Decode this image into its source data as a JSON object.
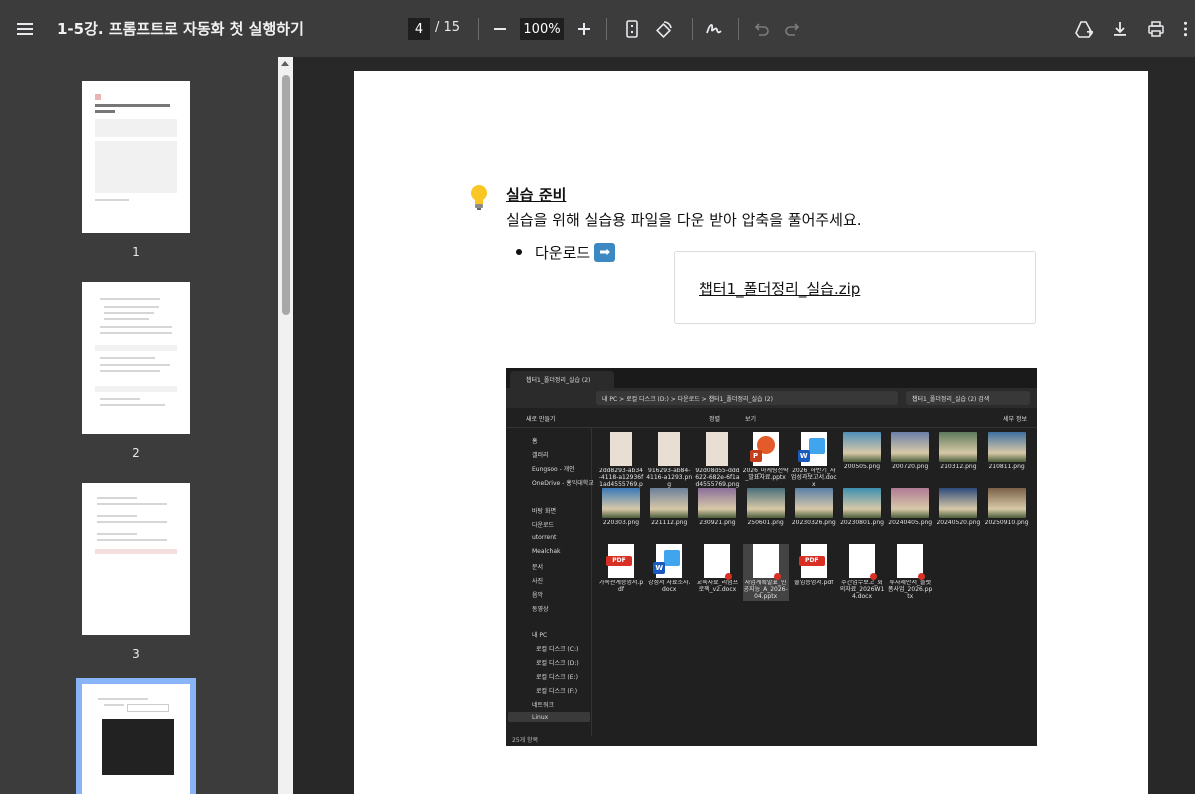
{
  "toolbar": {
    "title": "1-5강. 프롬프트로 자동화 첫 실행하기",
    "current_page": "4",
    "total_pages": "/ 15",
    "zoom": "100%"
  },
  "sidebar": {
    "thumbnails": [
      {
        "label": "1"
      },
      {
        "label": "2"
      },
      {
        "label": "3"
      }
    ]
  },
  "page": {
    "callout_title": "실습 준비",
    "callout_text": "실습을 위해 실습용 파일을 다운 받아 압축을 풀어주세요.",
    "download_label": "다운로드",
    "arrow_glyph": "➡",
    "file_link": "챕터1_폴더정리_실습.zip"
  },
  "explorer": {
    "tab_title": "챕터1_폴더정리_실습 (2)",
    "address": "내 PC  >  로컬 디스크 (D:)  >  다운로드  >  챕터1_폴더정리_실습 (2)",
    "search_placeholder": "챕터1_폴더정리_실습 (2) 검색",
    "cmd_new": "새로 만들기",
    "cmd_sort": "정렬",
    "cmd_view": "보기",
    "cmd_details": "세부 정보",
    "nav": [
      "홈",
      "갤러리",
      "Eungsoo - 개인",
      "OneDrive - 홍익대학교",
      "바탕 화면",
      "다운로드",
      "utorrent",
      "Mealchak",
      "문서",
      "사진",
      "음악",
      "동영상",
      "내 PC",
      "로컬 디스크 (C:)",
      "로컬 디스크 (D:)",
      "로컬 디스크 (E:)",
      "로컬 디스크 (F:)",
      "네트워크",
      "Linux"
    ],
    "status": "25개 항목",
    "files": [
      {
        "name": "2dd8293-ab34-4118-a12936f1ad4555769.png",
        "kind": "receipt"
      },
      {
        "name": "916293-ab84-4116-a1293.png",
        "kind": "receipt"
      },
      {
        "name": "92d08d55-ddd622-682e-6f1ad4555769.png",
        "kind": "receipt"
      },
      {
        "name": "2026_마케팅전략_발표자료.pptx",
        "kind": "pptx"
      },
      {
        "name": "2026_하반기_사업성과보고서.docx",
        "kind": "docx"
      },
      {
        "name": "200505.png",
        "kind": "photo",
        "color": "#4f8fb8"
      },
      {
        "name": "200720.png",
        "kind": "photo",
        "color": "#6a7fa8"
      },
      {
        "name": "210312.png",
        "kind": "photo",
        "color": "#5b7a5a"
      },
      {
        "name": "210811.png",
        "kind": "photo",
        "color": "#3f6fa0"
      },
      {
        "name": "220303.png",
        "kind": "photo",
        "color": "#3a79b8"
      },
      {
        "name": "221112.png",
        "kind": "photo",
        "color": "#6b7f9a"
      },
      {
        "name": "230921.png",
        "kind": "photo",
        "color": "#8a6f9a"
      },
      {
        "name": "250601.png",
        "kind": "photo",
        "color": "#4a6e7a"
      },
      {
        "name": "20230326.png",
        "kind": "photo",
        "color": "#5a7fa8"
      },
      {
        "name": "20230801.png",
        "kind": "photo",
        "color": "#3d8fb0"
      },
      {
        "name": "20240405.png",
        "kind": "photo",
        "color": "#b07a94"
      },
      {
        "name": "20240520.png",
        "kind": "photo",
        "color": "#2e4a7a"
      },
      {
        "name": "20250910.png",
        "kind": "photo",
        "color": "#7a6048"
      },
      {
        "name": "가족관계증명서.pdf",
        "kind": "pdf"
      },
      {
        "name": "강정서 자료조사.docx",
        "kind": "docx"
      },
      {
        "name": "교육자료_리덤프로젝_v2.docx",
        "kind": "blank"
      },
      {
        "name": "사업계획발표_인공지능_A_2026-04.pptx",
        "kind": "blank",
        "selected": true
      },
      {
        "name": "출입증명서.pdf",
        "kind": "pdf"
      },
      {
        "name": "주간업무보고_회의자료_2026W14.docx",
        "kind": "blank"
      },
      {
        "name": "투자제안서_플랫폼사업_2026.pptx",
        "kind": "blank"
      }
    ]
  }
}
